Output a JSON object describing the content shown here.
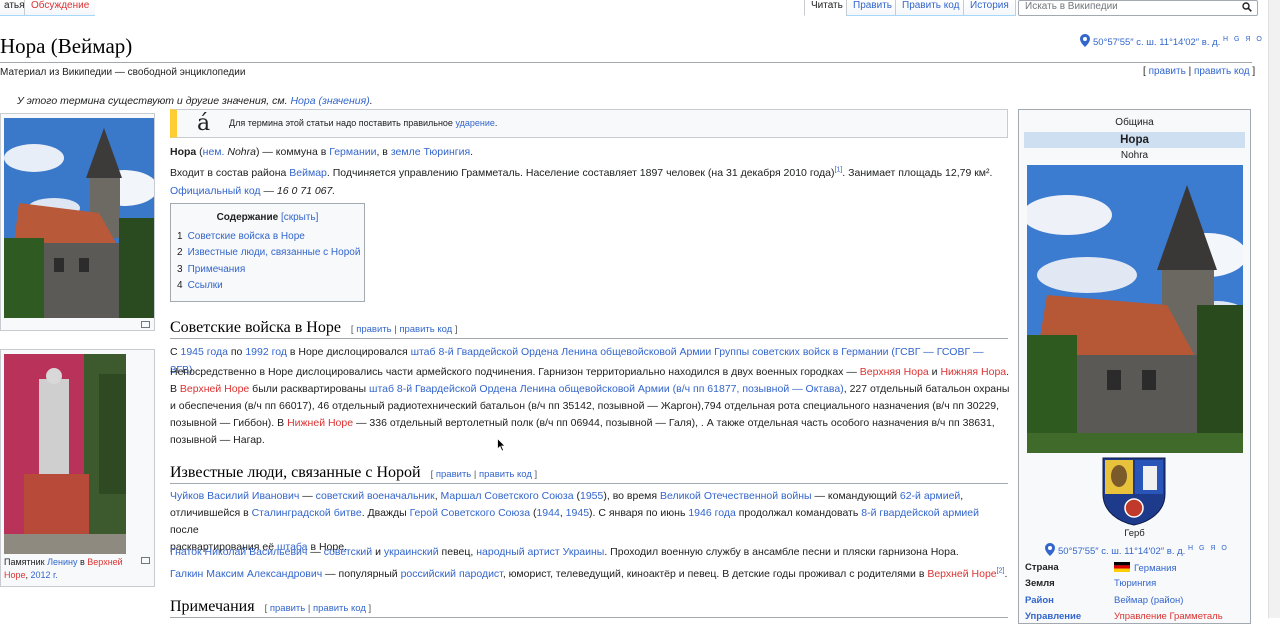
{
  "tabs": {
    "left_partial": "атья",
    "discussion": "Обсуждение",
    "read": "Читать",
    "edit": "Править",
    "edit_source": "Править код",
    "history": "История"
  },
  "search": {
    "placeholder": "Искать в Википедии"
  },
  "header": {
    "title": "Нора (Веймар)",
    "tagline": "Материал из Википедии — свободной энциклопедии",
    "coords": "50°57′55″ с. ш. 11°14′02″ в. д.",
    "coords_sup": "H G Я O",
    "edit_links": {
      "open": "[ ",
      "edit": "править",
      "sep": " | ",
      "edit_source": "править код",
      "close": " ]"
    }
  },
  "hatnote": {
    "text": "У этого термина существуют и другие значения, см. ",
    "link": "Нора (значения)",
    "end": "."
  },
  "notice": {
    "glyph": "á",
    "text": "Для термина этой статьи надо поставить правильное ",
    "link": "ударение",
    "end": "."
  },
  "lead": {
    "p1": {
      "bold": "Нора",
      "t1": " (",
      "lang": "нем.",
      "native": " Nohra",
      "t2": ") — коммуна в ",
      "country": "Германии",
      "t3": ", в ",
      "land": "земле Тюрингия",
      "t4": "."
    },
    "p2": {
      "t1": "Входит в состав района ",
      "district": "Веймар",
      "t2": ". Подчиняется управлению Грамметаль. Население составляет 1897 человек (на 31 декабря 2010 года)",
      "ref": "[1]",
      "t3": ". Занимает площадь 12,79 км².",
      "code_link": "Официальный код",
      "code_text": " — 16 0 71 067."
    }
  },
  "toc": {
    "title": "Содержание",
    "toggle": "[скрыть]",
    "items": [
      {
        "num": "1",
        "label": "Советские войска в Норе"
      },
      {
        "num": "2",
        "label": "Известные люди, связанные с Норой"
      },
      {
        "num": "3",
        "label": "Примечания"
      },
      {
        "num": "4",
        "label": "Ссылки"
      }
    ]
  },
  "sections": {
    "soviet": {
      "heading": "Советские войска в Норе",
      "edit": "править",
      "edit_source": "править код",
      "p1": {
        "t1": "С ",
        "y1": "1945 года",
        "t2": " по ",
        "y2": "1992 год",
        "t3": " в Норе дислоцировался ",
        "link": "штаб 8-й Гвардейской Ордена Ленина общевойсковой Армии Группы советских войск в Германии (ГСВГ — ГСОВГ — ЗГВ)",
        "t4": "."
      },
      "p2": {
        "t1": "Непосредственно в Норе дислоцировались части армейского подчинения. Гарнизон территориально находился в двух военных городках — ",
        "upper": "Верхняя Нора",
        "t2": " и ",
        "lower": "Нижняя Нора",
        "t3": ".",
        "t4": "В ",
        "upper2": "Верхней Норе",
        "t5": " были расквартированы ",
        "hq": "штаб 8-й Гвардейской Ордена Ленина общевойсковой Армии (в/ч пп 61877, позывной — Октава)",
        "t6": ", 227 отдельный батальон охраны",
        "line3": "и обеспечения (в/ч пп 66017), 46 отдельный радиотехнический батальон (в/ч пп 35142, позывной — Жаргон),794 отдельная рота специального назначения (в/ч пп 30229,",
        "t7": "позывной — Гиббон). В ",
        "lower2": "Нижней Норе",
        "t8": " — 336 отдельный вертолетный полк (в/ч пп 06944, позывной — Галя), . А также отдельная часть особого назначения в/ч пп 38631,",
        "line5": "позывной — Нагар."
      }
    },
    "people": {
      "heading": "Известные люди, связанные с Норой",
      "edit": "править",
      "edit_source": "править код",
      "p1": {
        "name": "Чуйков Василий Иванович",
        "t1": " — ",
        "l1": "советский военачальник",
        "t2": ", ",
        "l2": "Маршал Советского Союза",
        "t3": " (",
        "l3": "1955",
        "t4": "), во время ",
        "l4": "Великой Отечественной войны",
        "t5": " — командующий ",
        "l5": "62-й армией",
        "t6": ",",
        "t7": "отличившейся в ",
        "l6": "Сталинградской битве",
        "t8": ". Дважды ",
        "l7": "Герой Советского Союза",
        "t9": " (",
        "l8": "1944",
        "t10": ", ",
        "l9": "1945",
        "t11": "). С января по июнь ",
        "l10": "1946 года",
        "t12": " продолжал командовать ",
        "l11": "8-й гвардейской армией",
        "t13": " после",
        "t14": "расквартирования её ",
        "l12": "штаба",
        "t15": " в Норе."
      },
      "p2": {
        "name": "Гнаток Николай Васильевич",
        "t1": " — ",
        "l1": "советский",
        "t2": " и ",
        "l2": "украинский",
        "t3": " певец, ",
        "l3": "народный артист Украины",
        "t4": ". Проходил военную службу в ансамбле песни и пляски гарнизона Нора."
      },
      "p3": {
        "name": "Галкин Максим Александрович",
        "t1": " — популярный ",
        "l1": "российский",
        "t2": " ",
        "l2": "пародист",
        "t3": ", юморист, телеведущий, киноактёр и певец. В детские годы проживал с родителями в ",
        "l3": "Верхней Норе",
        "ref": "[2]",
        "t4": "."
      }
    },
    "notes": {
      "heading": "Примечания",
      "edit": "править",
      "edit_source": "править код"
    }
  },
  "thumb2_caption": {
    "t1": "Памятник ",
    "l1": "Ленину",
    "t2": " в ",
    "l2": "Верхней",
    "l3": "Норе",
    "t3": ", ",
    "l4": "2012 г."
  },
  "infobox": {
    "type": "Община",
    "name": "Нора",
    "native": "Nohra",
    "coat_caption": "Герб",
    "coords": "50°57′55″ с. ш. 11°14′02″ в. д.",
    "coords_sup": "H G Я O",
    "rows": [
      {
        "label": "Страна",
        "value": "Германия"
      },
      {
        "label": "Земля",
        "value": "Тюрингия"
      },
      {
        "label": "Район",
        "value": "Веймар (район)"
      },
      {
        "label": "Управление",
        "value": "Управление Грамметаль"
      }
    ]
  },
  "colors": {
    "link": "#3366cc",
    "redlink": "#dd3333",
    "infobox_header": "#cedff2",
    "notice_bar": "#ffcc33"
  }
}
